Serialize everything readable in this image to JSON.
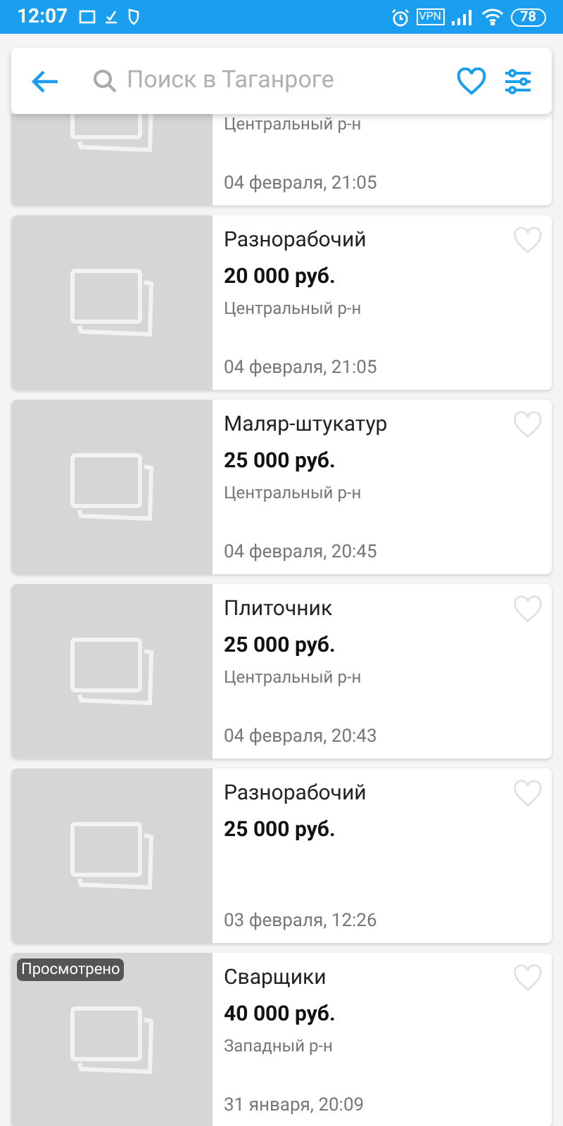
{
  "status_bar": {
    "time": "12:07",
    "vpn": "VPN",
    "battery": "78"
  },
  "search": {
    "placeholder": "Поиск в Таганроге"
  },
  "listings": [
    {
      "district": "Центральный р-н",
      "date": "04 февраля, 21:05"
    },
    {
      "title": "Разнорабочий",
      "price": "20 000 руб.",
      "district": "Центральный р-н",
      "date": "04 февраля, 21:05"
    },
    {
      "title": "Маляр-штукатур",
      "price": "25 000 руб.",
      "district": "Центральный р-н",
      "date": "04 февраля, 20:45"
    },
    {
      "title": "Плиточник",
      "price": "25 000 руб.",
      "district": "Центральный р-н",
      "date": "04 февраля, 20:43"
    },
    {
      "title": "Разнорабочий",
      "price": "25 000 руб.",
      "date": "03 февраля, 12:26"
    },
    {
      "title": "Сварщики",
      "price": "40 000 руб.",
      "district": "Западный р-н",
      "date": "31 января, 20:09",
      "badge": "Просмотрено"
    }
  ]
}
